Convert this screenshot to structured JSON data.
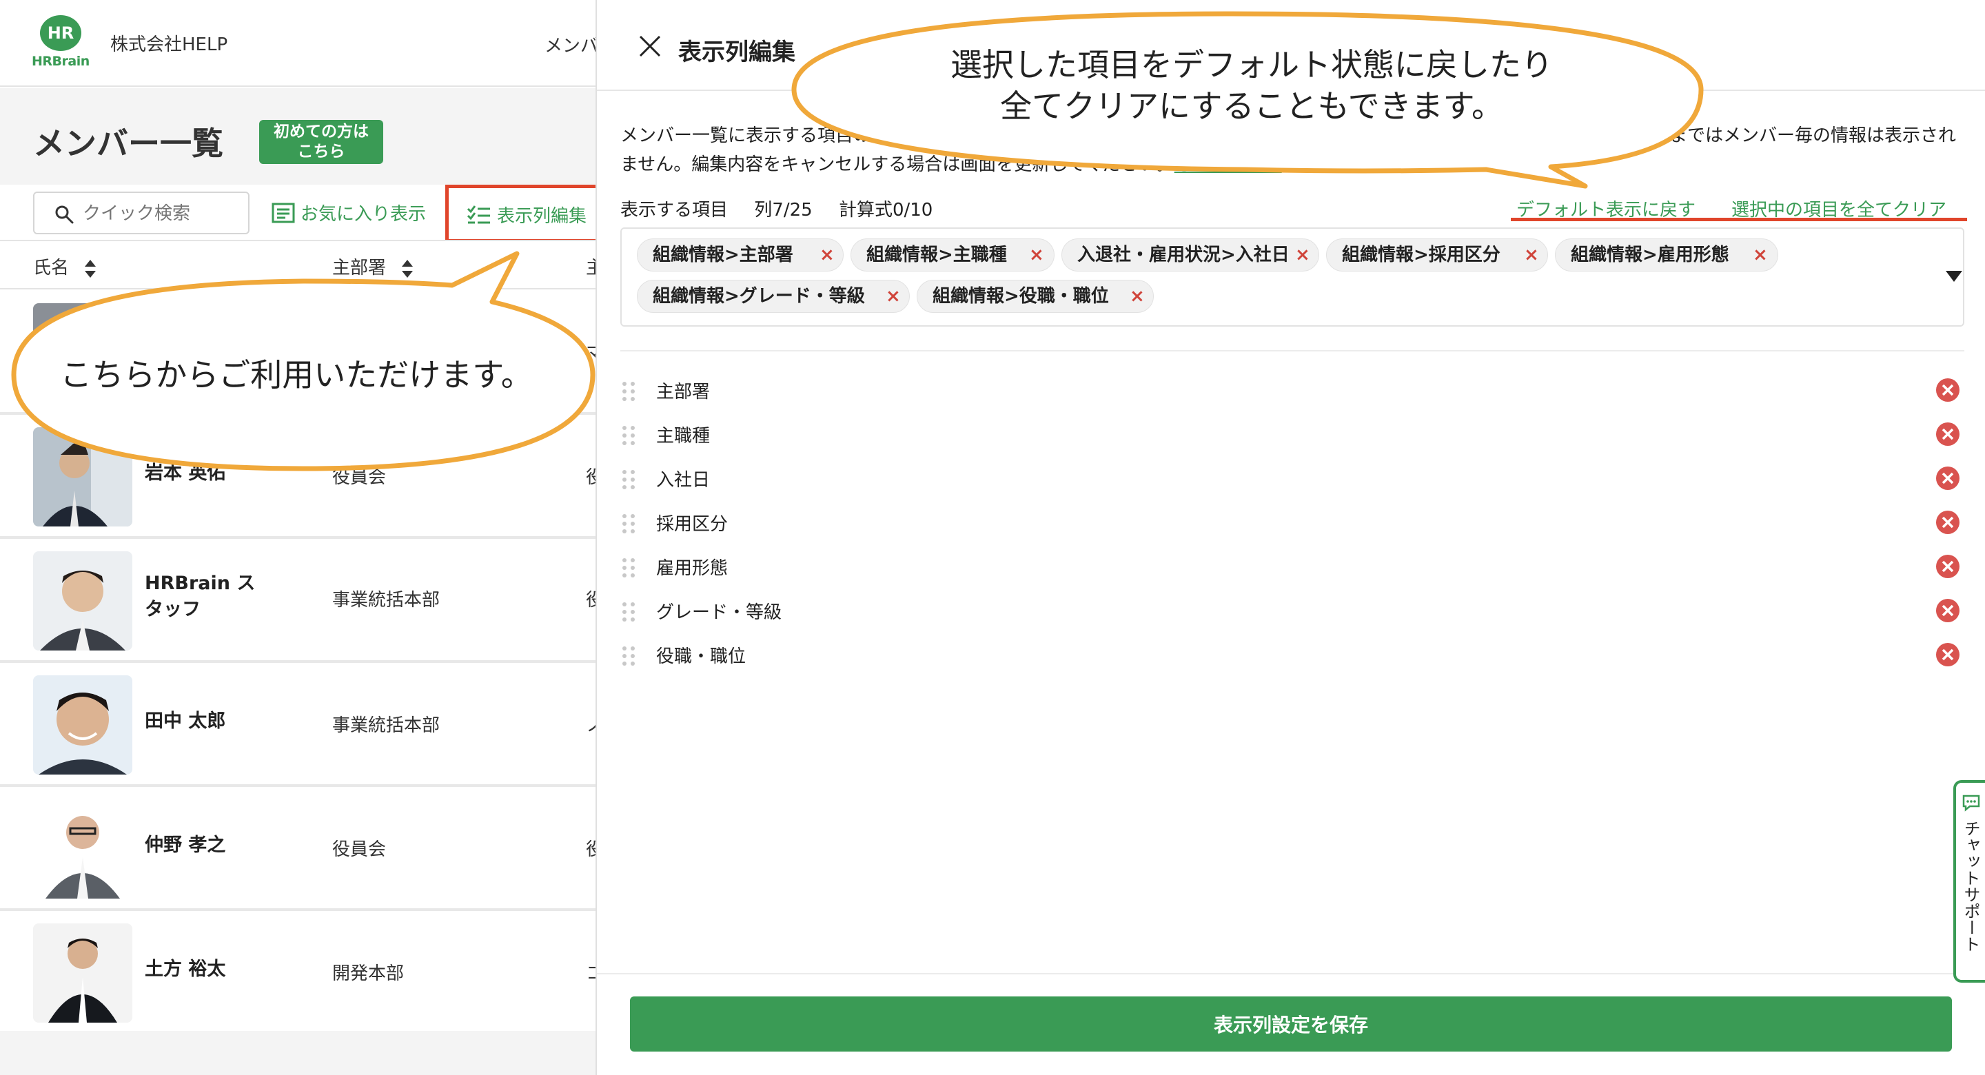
{
  "header": {
    "logo_mark": "HR",
    "logo_word": "HRBrain",
    "company": "株式会社HELP",
    "nav_partial": "メンバ"
  },
  "page": {
    "title": "メンバー一覧",
    "first_badge_line1": "初めての方は",
    "first_badge_line2": "こちら"
  },
  "toolbar": {
    "search_placeholder": "クイック検索",
    "favorites_label": "お気に入り表示",
    "column_edit_label": "表示列編集"
  },
  "table": {
    "columns": [
      "氏名",
      "主部署",
      "主"
    ],
    "rows": [
      {
        "name": "",
        "dept": "",
        "extra": "マ"
      },
      {
        "name": "岩本 英佑",
        "dept": "役員会",
        "extra": "役"
      },
      {
        "name": "HRBrain ス\nタッフ",
        "dept": "事業統括本部",
        "extra": "役"
      },
      {
        "name": "田中 太郎",
        "dept": "事業統括本部",
        "extra": "ノ"
      },
      {
        "name": "仲野 孝之",
        "dept": "役員会",
        "extra": "役"
      },
      {
        "name": "土方 裕太",
        "dept": "開発本部",
        "extra": "コ"
      }
    ]
  },
  "drawer": {
    "title": "表示列編集",
    "description_part1": "メンバー一覧に表示する項目の選",
    "description_part2": "されるまではメンバー毎の情報は表示され",
    "description_line2": "ません。編集内容をキャンセルする場合は画面を更新してください。",
    "description_link": "もっと詳しく",
    "counts": {
      "label": "表示する項目",
      "columns": "列7/25",
      "formulas": "計算式0/10"
    },
    "reset_default_label": "デフォルト表示に戻す",
    "clear_all_label": "選択中の項目を全てクリア",
    "chips": [
      "組織情報>主部署",
      "組織情報>主職種",
      "入退社・雇用状況>入社日",
      "組織情報>採用区分",
      "組織情報>雇用形態",
      "組織情報>グレード・等級",
      "組織情報>役職・職位"
    ],
    "chip_remove_symbol": "×",
    "selected_items": [
      "主部署",
      "主職種",
      "入社日",
      "採用区分",
      "雇用形態",
      "グレード・等級",
      "役職・職位"
    ],
    "save_label": "表示列設定を保存"
  },
  "chat": {
    "label": "チャットサポート"
  },
  "callouts": {
    "left": "こちらからご利用いただけます。",
    "right_line1": "選択した項目をデフォルト状態に戻したり",
    "right_line2": "全てクリアにすることもできます。"
  },
  "colors": {
    "brand_green": "#3a9b55",
    "highlight_red": "#e0452b",
    "callout_border": "#f0a83a"
  }
}
